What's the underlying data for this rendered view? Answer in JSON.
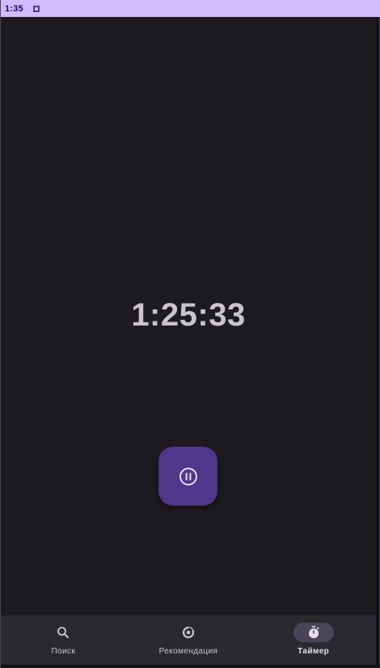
{
  "status_bar": {
    "time": "1:35",
    "notification_icon": "notification-square-icon"
  },
  "timer": {
    "display": "1:25:33"
  },
  "fab": {
    "icon": "pause-circle-icon",
    "accent": "#4f378b"
  },
  "nav": {
    "items": [
      {
        "label": "Поиск",
        "icon": "search-icon",
        "active": false
      },
      {
        "label": "Рекомендация",
        "icon": "recommendation-icon",
        "active": false
      },
      {
        "label": "Таймер",
        "icon": "stopwatch-icon",
        "active": true
      }
    ]
  },
  "colors": {
    "background": "#1d1b20",
    "status_bar": "#d0bcff",
    "nav_bar": "#2b2930",
    "active_indicator": "#4a4458",
    "text": "#cac4d0"
  }
}
